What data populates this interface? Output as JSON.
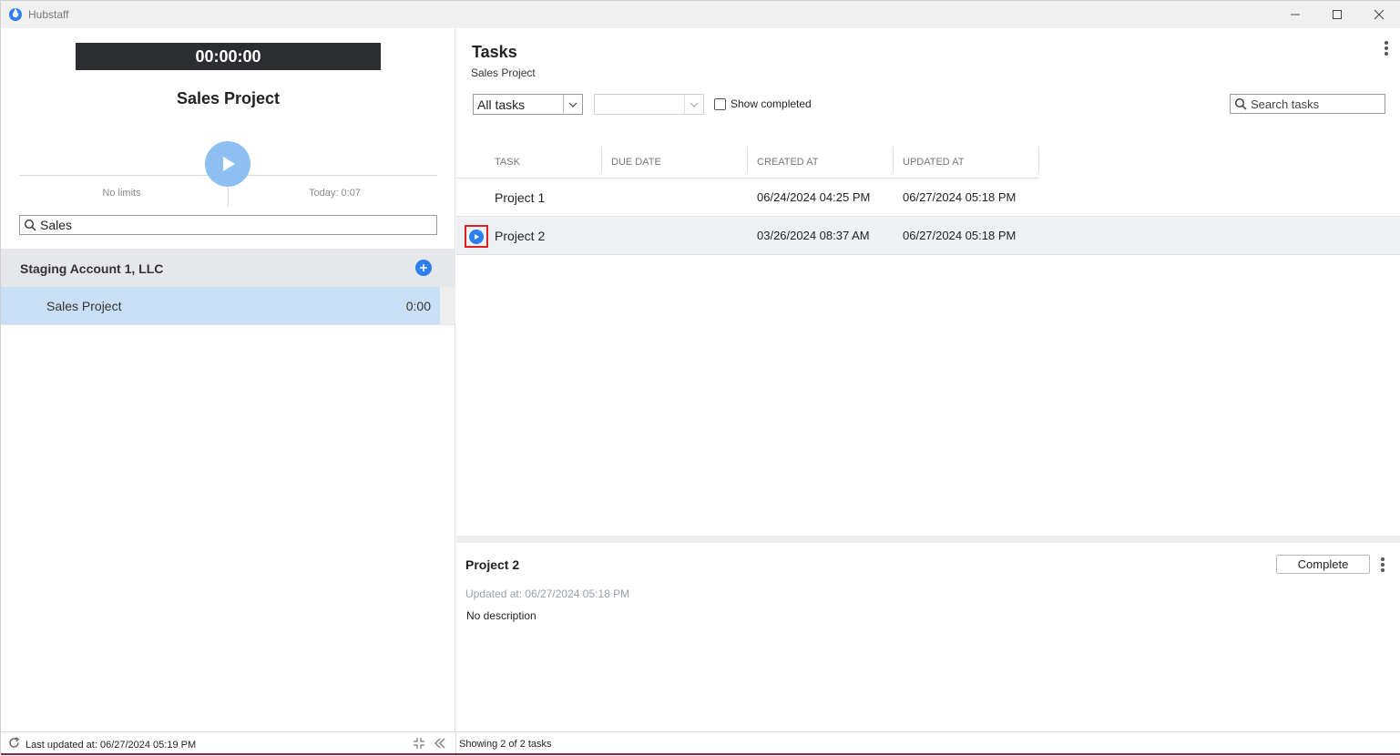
{
  "window": {
    "title": "Hubstaff",
    "controls": [
      "minimize-icon",
      "maximize-icon",
      "close-icon"
    ]
  },
  "timer": {
    "display": "00:00:00",
    "project": "Sales Project",
    "limits": "No limits",
    "today": "Today: 0:07"
  },
  "left_search": {
    "value": "Sales",
    "icon": "search-icon"
  },
  "organization": {
    "name": "Staging Account 1, LLC",
    "projects": [
      {
        "name": "Sales Project",
        "time": "0:00"
      }
    ]
  },
  "tasks_panel": {
    "title": "Tasks",
    "subtitle": "Sales Project",
    "filter": {
      "selected": "All tasks"
    },
    "secondary_filter": {
      "selected": ""
    },
    "show_completed_label": "Show completed",
    "search_placeholder": "Search tasks",
    "columns": [
      "TASK",
      "DUE DATE",
      "CREATED AT",
      "UPDATED AT"
    ],
    "rows": [
      {
        "task": "Project 1",
        "due": "",
        "created": "06/24/2024 04:25 PM",
        "updated": "06/27/2024 05:18 PM"
      },
      {
        "task": "Project 2",
        "due": "",
        "created": "03/26/2024 08:37 AM",
        "updated": "06/27/2024 05:18 PM"
      }
    ]
  },
  "detail": {
    "title": "Project 2",
    "complete_label": "Complete",
    "updated": "Updated at: 06/27/2024 05:18 PM",
    "description": "No description"
  },
  "status_bar": {
    "last_updated": "Last updated at: 06/27/2024 05:19 PM",
    "showing": "Showing 2 of 2 tasks"
  },
  "colors": {
    "accent": "#2d7ff0",
    "timer_bg": "#2b2d31",
    "selected_row": "#c9dff6",
    "highlight_box": "#e02020"
  }
}
